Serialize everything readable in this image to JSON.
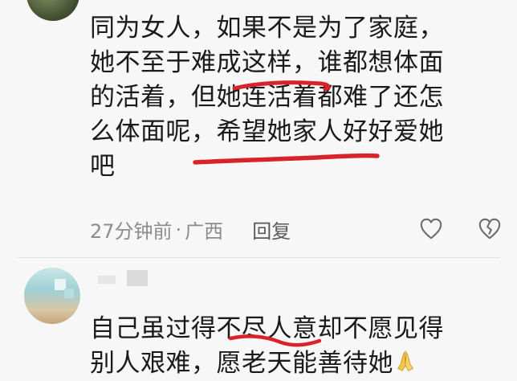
{
  "comment1": {
    "lines": [
      "同为女人，如果不是为了家庭，",
      "她不至于难成这样，谁都想体面",
      "的活着，但她连活着都难了还怎",
      "么体面呢，希望她家人好好爱她",
      "吧"
    ],
    "time": "27分钟前",
    "separator": "·",
    "location": "广西",
    "reply_label": "回复"
  },
  "comment2": {
    "lines": [
      "自己虽过得不尽人意却不愿见得",
      "别人艰难，愿老天能善待她"
    ]
  },
  "icons": {
    "like": "heart-outline-icon",
    "dislike": "broken-heart-icon",
    "pray": "praying-hands-emoji"
  },
  "colors": {
    "underline": "#d9232b",
    "meta_text": "#8c8c8c",
    "body_text": "#1a1a1a"
  }
}
